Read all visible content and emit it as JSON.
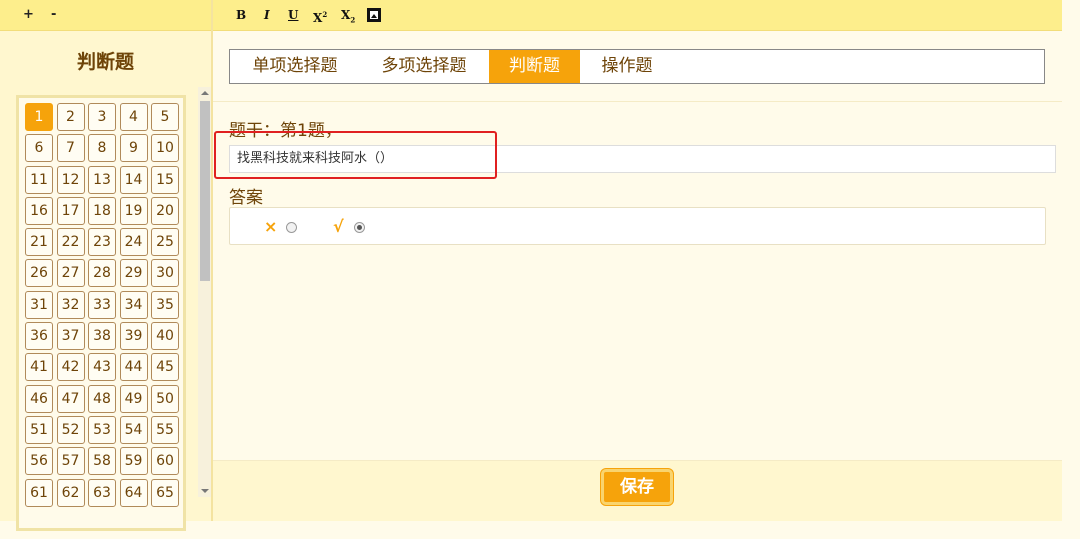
{
  "toolbar": {
    "zoom_in": "+",
    "zoom_out": "-",
    "bold": "B",
    "italic": "I",
    "underline": "U",
    "superscript_base": "X",
    "superscript_mark": "2",
    "subscript_base": "X",
    "subscript_mark": "2",
    "image_icon": "image-icon"
  },
  "sidebar": {
    "title": "判断题",
    "numbers": [
      "1",
      "2",
      "3",
      "4",
      "5",
      "6",
      "7",
      "8",
      "9",
      "10",
      "11",
      "12",
      "13",
      "14",
      "15",
      "16",
      "17",
      "18",
      "19",
      "20",
      "21",
      "22",
      "23",
      "24",
      "25",
      "26",
      "27",
      "28",
      "29",
      "30",
      "31",
      "32",
      "33",
      "34",
      "35",
      "36",
      "37",
      "38",
      "39",
      "40",
      "41",
      "42",
      "43",
      "44",
      "45",
      "46",
      "47",
      "48",
      "49",
      "50",
      "51",
      "52",
      "53",
      "54",
      "55",
      "56",
      "57",
      "58",
      "59",
      "60",
      "61",
      "62",
      "63",
      "64",
      "65"
    ],
    "active_number": "1"
  },
  "tabs": [
    {
      "label": "单项选择题",
      "active": false
    },
    {
      "label": "多项选择题",
      "active": false
    },
    {
      "label": "判断题",
      "active": true
    },
    {
      "label": "操作题",
      "active": false
    }
  ],
  "question": {
    "stem_label": "题干：第1题，",
    "input_value": "找黑科技就来科技阿水（）"
  },
  "answer": {
    "label": "答案",
    "false_symbol": "×",
    "true_symbol": "√",
    "selected": "true"
  },
  "save_label": "保存",
  "colors": {
    "accent": "#f6a30b",
    "topbar": "#fdee8c",
    "text": "#6e4408",
    "highlight": "#e02020"
  }
}
